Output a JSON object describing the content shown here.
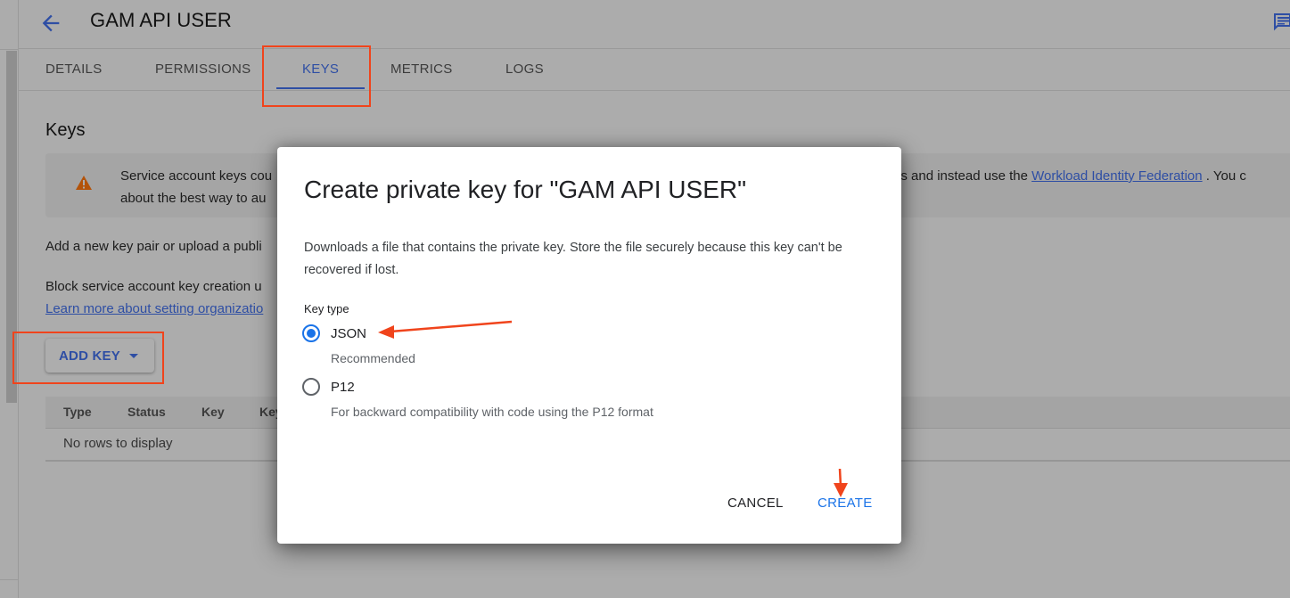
{
  "header": {
    "title": "GAM API USER",
    "back_icon": "arrow-back-icon",
    "feedback_icon": "feedback-icon"
  },
  "tabs": [
    {
      "label": "DETAILS",
      "active": false
    },
    {
      "label": "PERMISSIONS",
      "active": false
    },
    {
      "label": "KEYS",
      "active": true
    },
    {
      "label": "METRICS",
      "active": false
    },
    {
      "label": "LOGS",
      "active": false
    }
  ],
  "section": {
    "title": "Keys"
  },
  "warning": {
    "icon": "warning-icon",
    "line1_start": "Service account keys cou",
    "line1_end": "keys and instead use the ",
    "link": "Workload Identity Federation",
    "line1_tail": " . You c",
    "line2": "about the best way to au"
  },
  "body": {
    "add_text": "Add a new key pair or upload a publi",
    "block_text": "Block service account key creation u",
    "learn_more_link": "Learn more about setting organizatio"
  },
  "add_key_button": {
    "label": "ADD KEY",
    "icon": "caret-down-icon"
  },
  "table": {
    "columns": [
      "Type",
      "Status",
      "Key",
      "Key"
    ],
    "empty_message": "No rows to display"
  },
  "dialog": {
    "title": "Create private key for \"GAM API USER\"",
    "description": "Downloads a file that contains the private key. Store the file securely because this key can't be recovered if lost.",
    "key_type_label": "Key type",
    "options": [
      {
        "label": "JSON",
        "help": "Recommended",
        "selected": true
      },
      {
        "label": "P12",
        "help": "For backward compatibility with code using the P12 format",
        "selected": false
      }
    ],
    "cancel_label": "CANCEL",
    "create_label": "CREATE"
  },
  "colors": {
    "accent": "#1a73e8",
    "annotation": "#f0441c",
    "scrim_background": "#acacac",
    "warning": "#b3530a"
  }
}
